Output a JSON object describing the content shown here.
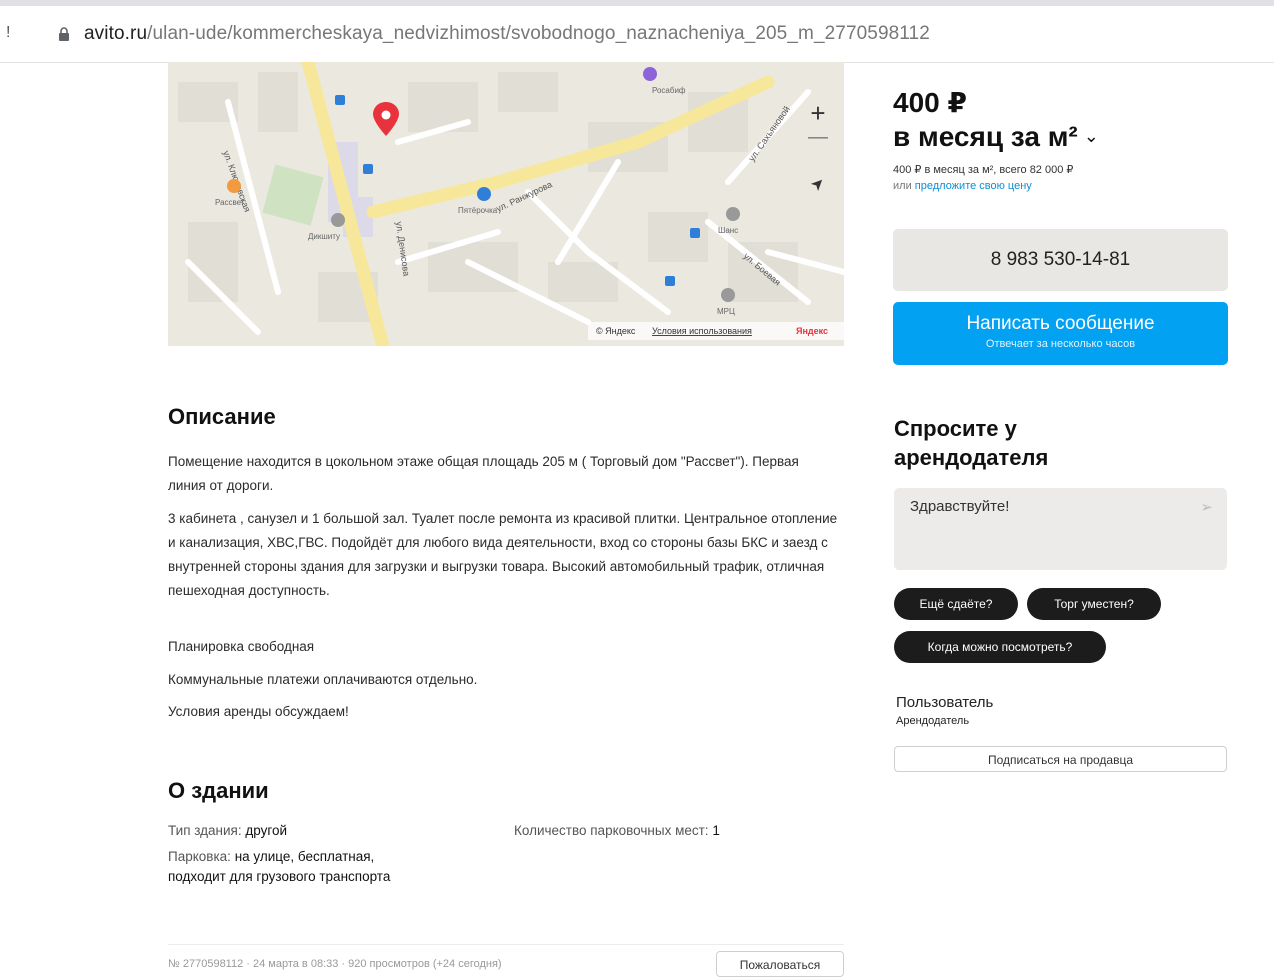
{
  "browser": {
    "url_host": "avito.ru",
    "url_path": "/ulan-ude/kommercheskaya_nedvizhimost/svobodnogo_naznacheniya_205_m_2770598112"
  },
  "map": {
    "labels": [
      "Росабиф",
      "Пятёрочка",
      "Рассвет",
      "Дикшиту",
      "Шанс",
      "МРЦ"
    ],
    "streets": [
      "ул. Ключевская",
      "ул. Ранжурова",
      "ул. Денисова",
      "ул. Боевая",
      "ул. Сахьяновой"
    ],
    "attribution": "© Яндекс",
    "terms_link": "Условия использования",
    "brand": "Яндекс",
    "zoom_in": "+",
    "zoom_out": "—",
    "locate": "➤"
  },
  "price": {
    "amount": "400 ₽",
    "unit": "в месяц за м²",
    "chevron": "⌄",
    "subline": "400 ₽ в месяц за м², всего 82 000 ₽",
    "or_text": "или",
    "propose_link": "предложите свою цену"
  },
  "contact": {
    "phone": "8 983 530-14-81",
    "message_button": "Написать сообщение",
    "message_note": "Отвечает за несколько часов"
  },
  "ask": {
    "title_line1": "Спросите у",
    "title_line2": "арендодателя",
    "input_value": "Здравствуйте!",
    "send_icon": "➢",
    "chips": [
      "Ещё сдаёте?",
      "Торг уместен?",
      "Когда можно посмотреть?"
    ]
  },
  "seller": {
    "name": "Пользователь",
    "role": "Арендодатель",
    "subscribe": "Подписаться на продавца"
  },
  "description": {
    "heading": "Описание",
    "p1": "Помещение находится в цокольном этаже общая площадь 205 м ( Торговый дом \"Рассвет\"). Первая линия от дороги.",
    "p2": "3 кабинета , санузел и 1 большой зал. Туалет после ремонта из красивой плитки. Центральное отопление и канализация, ХВС,ГВС. Подойдёт для любого вида деятельности, вход со стороны базы БКС и заезд с внутренней стороны здания для загрузки и выгрузки товара. Высокий автомобильный трафик, отличная пешеходная доступность.",
    "p3": "Планировка свободная",
    "p4": "Коммунальные платежи оплачиваются отдельно.",
    "p5": "Условия аренды обсуждаем!"
  },
  "building": {
    "heading": "О здании",
    "type_label": "Тип здания:",
    "type_value": "другой",
    "parking_label": "Парковка:",
    "parking_value": "на улице, бесплатная,",
    "parking_value2": "подходит для грузового транспорта",
    "spots_label": "Количество парковочных мест:",
    "spots_value": "1"
  },
  "footer": {
    "meta": "№ 2770598112 · 24 марта в 08:33 · 920 просмотров (+24 сегодня)",
    "complain": "Пожаловаться"
  },
  "colors": {
    "accent_blue": "#02a1f2",
    "map_pin": "#e8333d",
    "chip_bg": "#1c1c1c"
  }
}
